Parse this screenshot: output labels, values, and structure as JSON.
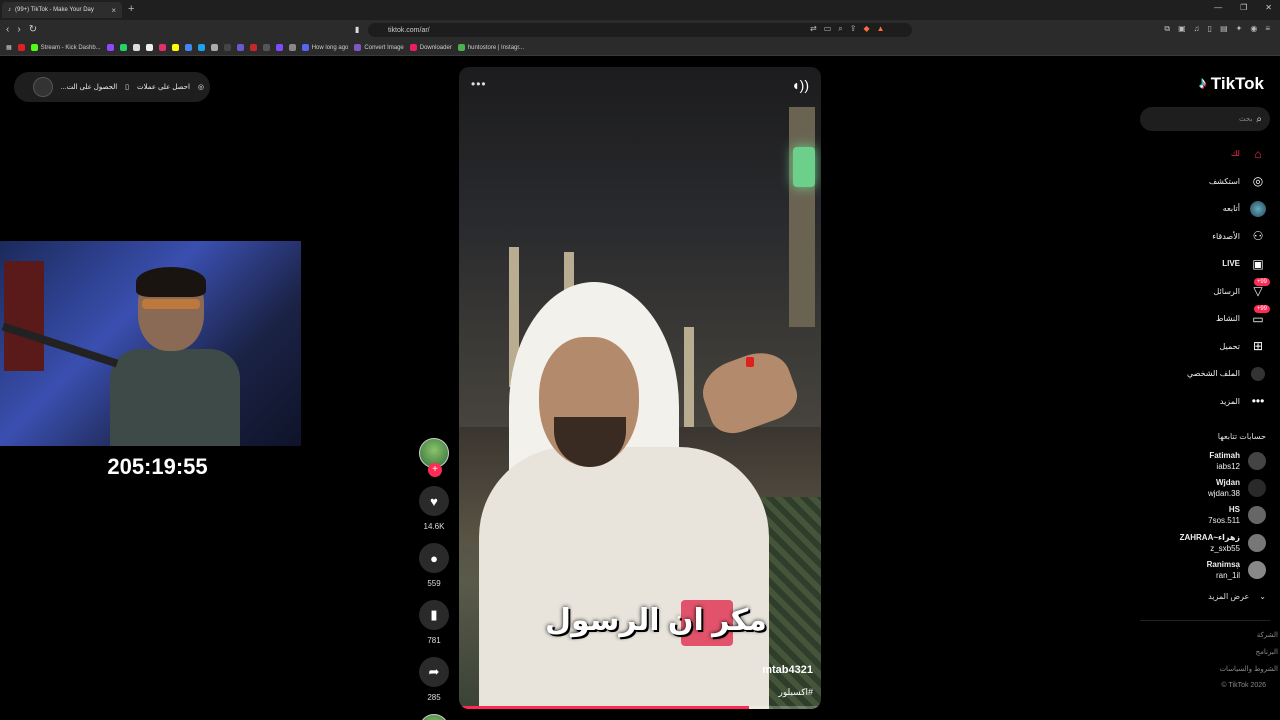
{
  "browser": {
    "tab_title": "(99+) TikTok - Make Your Day",
    "url": "tiktok.com/ar/",
    "bookmarks": [
      "Stream - Kick Dashb...",
      "How long ago",
      "Convert Image",
      "Downloader",
      "huntostore | Instagr..."
    ]
  },
  "overlay": {
    "promo_left": "الحصول على الت...",
    "promo_right": "احصل على عملات",
    "timer": "205:19:55"
  },
  "video": {
    "caption": "مكر ان الرسول",
    "username": "mtab4321",
    "hashtag": "#اكسبلور",
    "progress": 0.8
  },
  "actions": {
    "likes": "14.6K",
    "comments": "559",
    "saves": "781",
    "shares": "285"
  },
  "tiktok": {
    "logo": "TikTok",
    "search_placeholder": "بحث",
    "nav": [
      {
        "label": "لك",
        "icon": "home-icon"
      },
      {
        "label": "استكشف",
        "icon": "compass-icon"
      },
      {
        "label": "أتابعه",
        "icon": "avatar-icon"
      },
      {
        "label": "الأصدقاء",
        "icon": "friends-icon"
      },
      {
        "label": "LIVE",
        "icon": "live-icon"
      },
      {
        "label": "الرسائل",
        "icon": "messages-icon",
        "badge": "+99"
      },
      {
        "label": "النشاط",
        "icon": "activity-icon",
        "badge": "+99"
      },
      {
        "label": "تحميل",
        "icon": "upload-icon"
      },
      {
        "label": "الملف الشخصي",
        "icon": "profile-icon"
      },
      {
        "label": "المزيد",
        "icon": "more-icon"
      }
    ],
    "following_header": "حسابات تتابعها",
    "following": [
      {
        "name": "Fatimah",
        "handle": "iabs12"
      },
      {
        "name": "Wjdan",
        "handle": "wjdan.38"
      },
      {
        "name": "HS",
        "handle": "7sos.511"
      },
      {
        "name": "ZAHRAA~زهراء",
        "handle": "z_sxb55"
      },
      {
        "name": "Ranimsa᷂",
        "handle": "ran_1il"
      }
    ],
    "see_more": "عرض المزيد",
    "footer": [
      "الشركة",
      "البرنامج",
      "الشروط والسياسات",
      "TikTok 2026 ©"
    ]
  }
}
